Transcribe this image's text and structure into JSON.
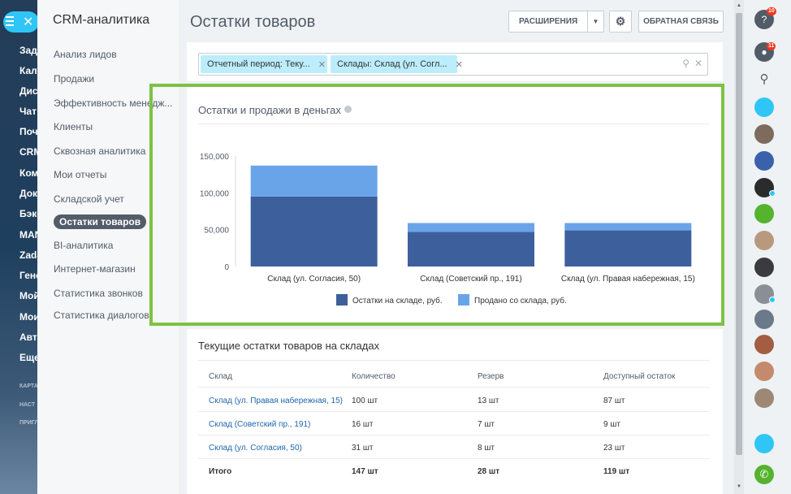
{
  "left_nav": {
    "items": [
      "Зада",
      "Кале",
      "Диск",
      "Чат",
      "Почт",
      "CRM",
      "Комп",
      "Доку",
      "Бэкс",
      "MAN",
      "Zada",
      "Гене",
      "Мой",
      "Мои",
      "Авто",
      "Еще"
    ],
    "small_items": [
      "КАРТА",
      "НАСТ",
      "ПРИГЛ"
    ]
  },
  "crm_menu": {
    "title": "CRM-аналитика",
    "items": [
      {
        "label": "Анализ лидов"
      },
      {
        "label": "Продажи"
      },
      {
        "label": "Эффективность менедж..."
      },
      {
        "label": "Клиенты"
      },
      {
        "label": "Сквозная аналитика"
      },
      {
        "label": "Мои отчеты"
      },
      {
        "label": "Складской учет"
      },
      {
        "label": "Остатки товаров",
        "active": true
      },
      {
        "label": "BI-аналитика"
      },
      {
        "label": "Интернет-магазин"
      },
      {
        "label": "Статистика звонков"
      },
      {
        "label": "Статистика диалогов"
      }
    ]
  },
  "header": {
    "title": "Остатки товаров",
    "extensions_label": "РАСШИРЕНИЯ",
    "feedback_label": "ОБРАТНАЯ СВЯЗЬ"
  },
  "filter": {
    "chips": [
      "Отчетный период: Теку...",
      "Склады: Склад (ул. Согл..."
    ]
  },
  "chart_card": {
    "title": "Остатки и продажи в деньгах"
  },
  "chart_data": {
    "type": "bar",
    "stacked": true,
    "title": "Остатки и продажи в деньгах",
    "categories": [
      "Склад (ул. Согласия, 50)",
      "Склад (Советский пр., 191)",
      "Склад (ул. Правая набережная, 15)"
    ],
    "series": [
      {
        "name": "Остатки на складе, руб.",
        "color": "#3d5f9c",
        "values": [
          95000,
          47000,
          49000
        ]
      },
      {
        "name": "Продано со склада, руб.",
        "color": "#6aa4e8",
        "values": [
          42000,
          12000,
          10000
        ]
      }
    ],
    "ylim": [
      0,
      150000
    ],
    "yticks": [
      "150,000",
      "100,000",
      "50,000",
      "0"
    ],
    "ytick_values": [
      150000,
      100000,
      50000,
      0
    ],
    "legend": "bottom"
  },
  "table": {
    "title": "Текущие остатки товаров на складах",
    "headers": [
      "Склад",
      "Количество",
      "Резерв",
      "Доступный остаток"
    ],
    "rows": [
      [
        "Склад (ул. Правая набережная, 15)",
        "100 шт",
        "13 шт",
        "87 шт"
      ],
      [
        "Склад (Советский пр., 191)",
        "16 шт",
        "7 шт",
        "9 шт"
      ],
      [
        "Склад (ул. Согласия, 50)",
        "31 шт",
        "8 шт",
        "23 шт"
      ]
    ],
    "total": [
      "Итого",
      "147 шт",
      "28 шт",
      "119 шт"
    ]
  },
  "right_bar": {
    "help_badge": "10",
    "notif_badge": "11"
  },
  "colors": {
    "accent": "#2fc6f6",
    "highlight_frame": "#7dc243",
    "link": "#2067b0"
  }
}
